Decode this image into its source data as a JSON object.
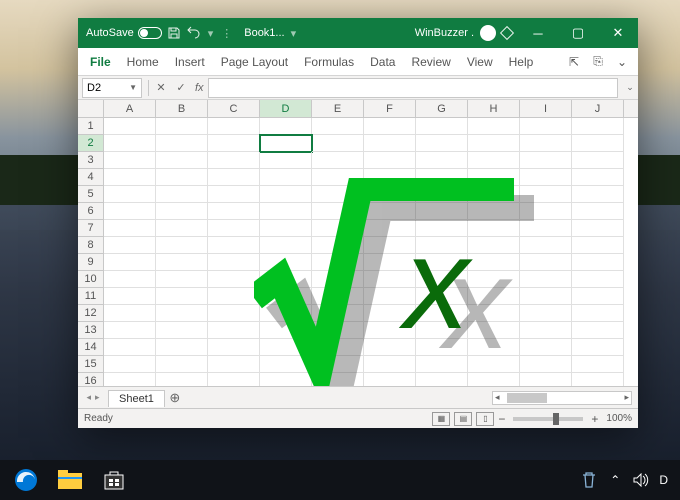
{
  "titlebar": {
    "autosave_label": "AutoSave",
    "autosave_state": "Off",
    "doc_title": "Book1...",
    "account_name": "WinBuzzer ."
  },
  "ribbon": {
    "tabs": [
      "File",
      "Home",
      "Insert",
      "Page Layout",
      "Formulas",
      "Data",
      "Review",
      "View",
      "Help"
    ]
  },
  "namebox": {
    "cell_ref": "D2",
    "fx_label": "fx"
  },
  "grid": {
    "columns": [
      "A",
      "B",
      "C",
      "D",
      "E",
      "F",
      "G",
      "H",
      "I",
      "J"
    ],
    "rows": [
      "1",
      "2",
      "3",
      "4",
      "5",
      "6",
      "7",
      "8",
      "9",
      "10",
      "11",
      "12",
      "13",
      "14",
      "15",
      "16"
    ],
    "selected_cell": "D2"
  },
  "sheets": {
    "active": "Sheet1"
  },
  "statusbar": {
    "status": "Ready",
    "zoom": "100%"
  },
  "systray": {
    "lang": "D"
  }
}
